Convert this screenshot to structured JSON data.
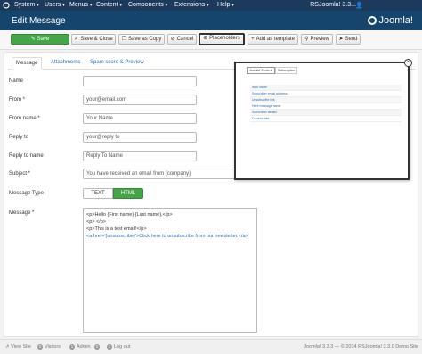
{
  "topbar": {
    "menu": [
      "System",
      "Users",
      "Menus",
      "Content",
      "Components",
      "Extensions",
      "Help"
    ],
    "site_title": "RSJoomla! 3.3..."
  },
  "header": {
    "page_title": "Edit Message",
    "brand": "Joomla!"
  },
  "toolbar": {
    "save": "Save",
    "save_close": "Save & Close",
    "save_copy": "Save as Copy",
    "cancel": "Cancel",
    "placeholders": "Placeholders",
    "add_template": "Add as template",
    "preview": "Preview",
    "send": "Send"
  },
  "tabs": [
    "Message",
    "Attachments",
    "Spam score & Preview"
  ],
  "form": {
    "name_label": "Name",
    "name_value": "",
    "from_label": "From *",
    "from_value": "your@email.com",
    "from_name_label": "From name *",
    "from_name_value": "Your Name",
    "reply_to_label": "Reply to",
    "reply_to_value": "your@reply to",
    "reply_to_name_label": "Reply to name",
    "reply_to_name_value": "Reply To Name",
    "subject_label": "Subject *",
    "subject_value": "You have received an email from {company}",
    "message_type_label": "Message Type",
    "type_text": "TEXT",
    "type_html": "HTML",
    "type_selected": "HTML",
    "message_label": "Message *",
    "message_lines": [
      "<p>Hello {First name} {Last name},</p>",
      "<p> </p>",
      "<p>This is a test email!</p>",
      "<a href='{unsubscribe}'>Click here to unsubscribe from our newsletter.</a>"
    ]
  },
  "popup": {
    "tabs": [
      "Joomla! Content",
      "Subscription"
    ],
    "items": [
      "Web name",
      "Subscriber email address",
      "Unsubscribe link",
      "Here message name",
      "Subscriber details",
      "Current date"
    ]
  },
  "statusbar": {
    "view_site": "View Site",
    "visitors_count": "0",
    "visitors": "Visitors",
    "admin_count": "1",
    "admin": "Admin",
    "messages_count": "0",
    "logout_count": "1",
    "logout": "Log out",
    "copyright": "Joomla! 3.3.3 — © 2014 RSJoomla! 3.3.0 Demo Site"
  },
  "colors": {
    "topbar": "#1b3a5c",
    "titlebar": "#15446d",
    "success": "#46a546",
    "link": "#2a6fb0"
  }
}
